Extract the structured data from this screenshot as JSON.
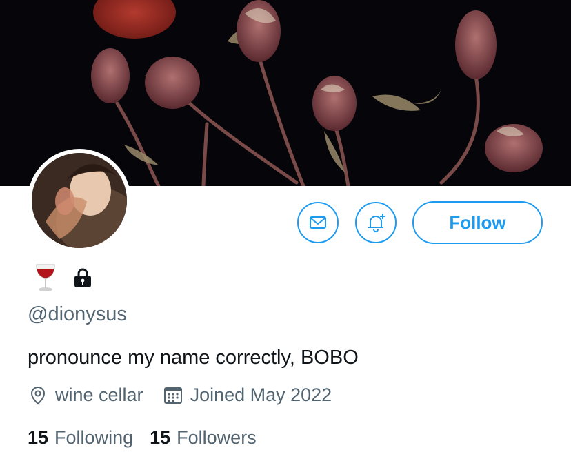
{
  "profile": {
    "name_icons": [
      "wine-glass-icon",
      "lock-icon"
    ],
    "handle": "@dionysus",
    "bio": "pronounce my name correctly, BOBO",
    "location": "wine cellar",
    "joined": "Joined May 2022",
    "following_count": "15",
    "following_label": "Following",
    "followers_count": "15",
    "followers_label": "Followers"
  },
  "actions": {
    "message_icon": "mail-icon",
    "notify_icon": "bell-plus-icon",
    "follow_label": "Follow"
  },
  "colors": {
    "accent": "#1d9bf0",
    "secondary_text": "#536471",
    "primary_text": "#0f1419",
    "banner_background": "#06060a"
  }
}
